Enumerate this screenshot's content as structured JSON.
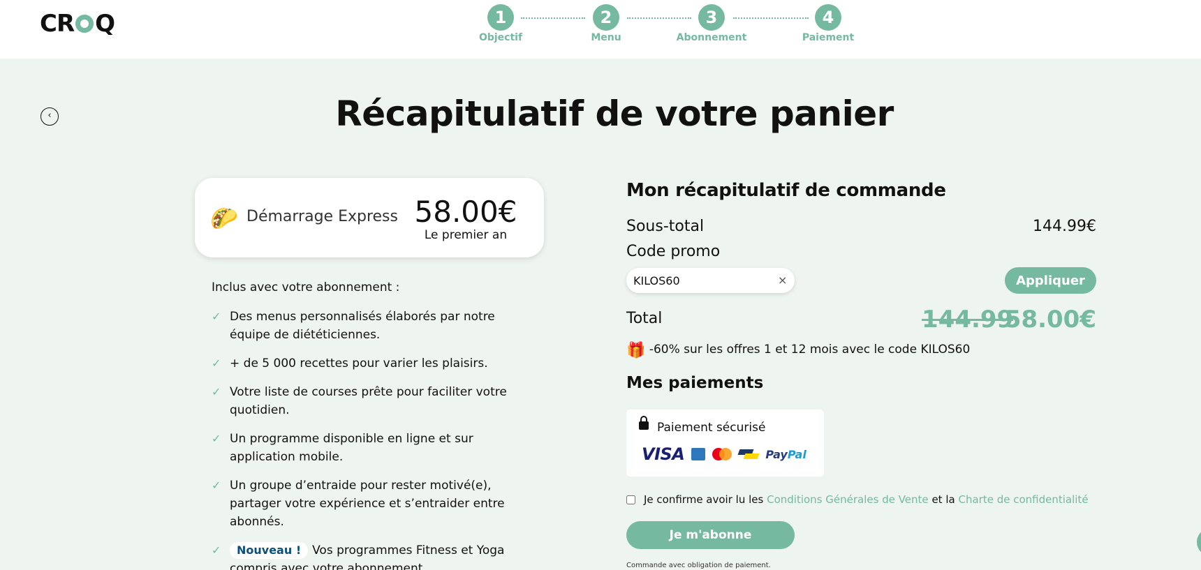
{
  "header": {
    "logo": [
      "CR",
      "Q"
    ],
    "steps": [
      {
        "number": "1",
        "label": "Objectif"
      },
      {
        "number": "2",
        "label": "Menu"
      },
      {
        "number": "3",
        "label": "Abonnement"
      },
      {
        "number": "4",
        "label": "Paiement"
      }
    ]
  },
  "page": {
    "back_icon": "‹",
    "title": "Récapitulatif de votre panier"
  },
  "plan": {
    "icon": "🌮",
    "name": "Démarrage Express",
    "price": "58.00€",
    "period": "Le premier an"
  },
  "included": {
    "title": "Inclus avec votre abonnement :",
    "check_icon": "✓",
    "items": [
      "Des menus personnalisés élaborés par notre équipe de diététiciennes.",
      "+ de 5 000 recettes pour varier les plaisirs.",
      "Votre liste de courses prête pour faciliter votre quotidien.",
      "Un programme disponible en ligne et sur application mobile.",
      "Un groupe d’entraide pour rester motivé(e), partager votre expérience et s’entraider entre abonnés."
    ],
    "new_item": {
      "badge": "Nouveau !",
      "text": "Vos programmes Fitness et Yoga compris avec votre abonnement."
    }
  },
  "summary": {
    "title": "Mon récapitulatif de commande",
    "subtotal_label": "Sous-total",
    "subtotal_value": "144.99€",
    "promo_label": "Code promo",
    "promo_value": "KILOS60",
    "promo_clear": "×",
    "apply_label": "Appliquer",
    "total_label": "Total",
    "total_old": "144.99",
    "total_new": "58.00€",
    "offer_icon": "🎁",
    "offer_text": "-60% sur les offres 1 et 12 mois avec le code KILOS60"
  },
  "payments": {
    "title": "Mes paiements",
    "secure_label": "Paiement sécurisé",
    "visa": "VISA",
    "paypal": [
      "Pay",
      "Pal"
    ]
  },
  "consent": {
    "text_1": "Je confirme avoir lu les",
    "link_1": "Conditions Générales de Vente",
    "text_2": "et la",
    "link_2": "Charte de confidentialité"
  },
  "subscribe_label": "Je m'abonne",
  "legal": "Commande avec obligation de paiement.",
  "colors": {
    "accent": "#74b9a0",
    "background": "#eef4f0"
  }
}
